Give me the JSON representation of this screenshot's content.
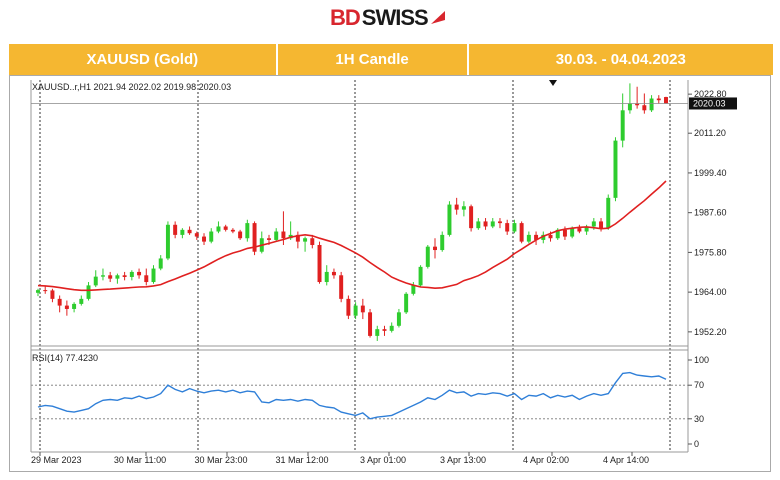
{
  "brand": {
    "bd": "BD",
    "swiss": "SWISS"
  },
  "header": {
    "symbol": "XAUUSD (Gold)",
    "timeframe": "1H Candle",
    "range": "30.03. - 04.04.2023"
  },
  "colors": {
    "header": "#f5b731",
    "bull": "#2ecc2e",
    "bear": "#e02020",
    "ma": "#e02020",
    "rsi": "#2f7fd8",
    "logo_red": "#d8262e"
  },
  "chart_data": {
    "type": "candlestick",
    "info": "XAUUSD..r,H1  2021.94 2022.02 2019.98 2020.03",
    "price_label": "2020.03",
    "y_ticks": [
      "2022.80",
      "2011.20",
      "1999.40",
      "1987.60",
      "1975.80",
      "1964.00",
      "1952.20"
    ],
    "x_ticks": [
      "29 Mar 2023",
      "30 Mar 11:00",
      "30 Mar 23:00",
      "31 Mar 12:00",
      "3 Apr 01:00",
      "3 Apr 13:00",
      "4 Apr 02:00",
      "4 Apr 14:00"
    ],
    "ylim": [
      1948,
      2027
    ],
    "ohlc": [
      [
        1963.8,
        1965,
        1962.8,
        1964.6
      ],
      [
        1964.6,
        1966,
        1963.5,
        1964.5
      ],
      [
        1964.5,
        1965,
        1961,
        1962
      ],
      [
        1962,
        1963,
        1958,
        1960
      ],
      [
        1960,
        1961.5,
        1957,
        1959
      ],
      [
        1959,
        1961,
        1958,
        1960.5
      ],
      [
        1960.5,
        1963,
        1960,
        1962
      ],
      [
        1962,
        1967,
        1961.5,
        1966
      ],
      [
        1966,
        1970.5,
        1965.5,
        1968.6
      ],
      [
        1968.6,
        1971,
        1967.5,
        1969
      ],
      [
        1969,
        1970,
        1967,
        1968
      ],
      [
        1968,
        1969.5,
        1966.5,
        1969
      ],
      [
        1969,
        1970,
        1967.5,
        1968.5
      ],
      [
        1968.5,
        1970.5,
        1967.5,
        1970
      ],
      [
        1970,
        1971,
        1968,
        1969
      ],
      [
        1969,
        1971,
        1966,
        1967
      ],
      [
        1967,
        1972,
        1966.5,
        1971
      ],
      [
        1971,
        1975,
        1970.5,
        1974
      ],
      [
        1974,
        1985,
        1973.5,
        1984
      ],
      [
        1984,
        1985,
        1980,
        1981
      ],
      [
        1981,
        1983,
        1980,
        1982.5
      ],
      [
        1982.5,
        1983.5,
        1981,
        1981.5
      ],
      [
        1981.5,
        1982,
        1979.5,
        1980.5
      ],
      [
        1980.5,
        1981.5,
        1978,
        1979
      ],
      [
        1979,
        1983,
        1978.5,
        1982
      ],
      [
        1982,
        1985,
        1981.5,
        1983.5
      ],
      [
        1983.5,
        1984,
        1982,
        1982.5
      ],
      [
        1982.5,
        1983,
        1981.5,
        1982
      ],
      [
        1982,
        1982.5,
        1979.5,
        1980
      ],
      [
        1980,
        1985.5,
        1979,
        1984.5
      ],
      [
        1984.5,
        1985,
        1975,
        1976
      ],
      [
        1976,
        1982,
        1975.5,
        1980
      ],
      [
        1980,
        1981,
        1978,
        1979.5
      ],
      [
        1979.5,
        1983,
        1979,
        1982
      ],
      [
        1982,
        1988,
        1978,
        1980
      ],
      [
        1980,
        1985,
        1979.5,
        1981
      ],
      [
        1981,
        1982,
        1977,
        1979
      ],
      [
        1979,
        1980.5,
        1976,
        1980
      ],
      [
        1980,
        1981,
        1977,
        1978
      ],
      [
        1978,
        1979,
        1966.5,
        1967
      ],
      [
        1967,
        1972,
        1966,
        1970
      ],
      [
        1970,
        1971,
        1968,
        1969
      ],
      [
        1969,
        1970,
        1961,
        1962
      ],
      [
        1962,
        1963,
        1956,
        1957
      ],
      [
        1957,
        1961,
        1956,
        1960
      ],
      [
        1960,
        1962,
        1956,
        1958
      ],
      [
        1958,
        1959,
        1950.5,
        1951
      ],
      [
        1951,
        1954,
        1949.5,
        1953
      ],
      [
        1953,
        1954,
        1951,
        1952.5
      ],
      [
        1952.5,
        1955,
        1952,
        1954
      ],
      [
        1954,
        1959,
        1953.5,
        1958
      ],
      [
        1958,
        1964,
        1957.5,
        1963.5
      ],
      [
        1963.5,
        1967,
        1963,
        1966
      ],
      [
        1966,
        1972,
        1965.5,
        1971.5
      ],
      [
        1971.5,
        1978,
        1971,
        1977.5
      ],
      [
        1977.5,
        1980,
        1974,
        1976.5
      ],
      [
        1976.5,
        1982,
        1976,
        1981
      ],
      [
        1981,
        1991,
        1980.5,
        1990
      ],
      [
        1990,
        1992,
        1987,
        1988.5
      ],
      [
        1988.5,
        1991,
        1986.5,
        1989.5
      ],
      [
        1989.5,
        1990,
        1982,
        1983
      ],
      [
        1983,
        1986,
        1982.5,
        1985
      ],
      [
        1985,
        1986,
        1982.5,
        1983.5
      ],
      [
        1983.5,
        1986,
        1983,
        1985
      ],
      [
        1985,
        1986,
        1983,
        1984.5
      ],
      [
        1984.5,
        1985.5,
        1981,
        1982
      ],
      [
        1982,
        1985.5,
        1981.5,
        1984.5
      ],
      [
        1984.5,
        1985,
        1978.5,
        1979
      ],
      [
        1979,
        1982,
        1978.5,
        1981
      ],
      [
        1981,
        1982,
        1978,
        1979.5
      ],
      [
        1979.5,
        1982,
        1978.5,
        1981
      ],
      [
        1981,
        1982,
        1979,
        1980
      ],
      [
        1980,
        1983,
        1979.5,
        1982.5
      ],
      [
        1982.5,
        1983.5,
        1979.5,
        1980.5
      ],
      [
        1980.5,
        1983.5,
        1980,
        1983
      ],
      [
        1983,
        1984,
        1981.5,
        1982
      ],
      [
        1982,
        1984,
        1981,
        1983.5
      ],
      [
        1983.5,
        1986,
        1982.5,
        1985
      ],
      [
        1985,
        1986,
        1982,
        1983
      ],
      [
        1983,
        1993,
        1982.5,
        1992
      ],
      [
        1992,
        2010,
        1991,
        2009
      ],
      [
        2009,
        2023,
        2007,
        2018
      ],
      [
        2018,
        2026,
        2017,
        2020
      ],
      [
        2020,
        2025,
        2018.5,
        2019.5
      ],
      [
        2019.5,
        2023,
        2017,
        2018
      ],
      [
        2018,
        2022.5,
        2017.5,
        2021.5
      ],
      [
        2021.5,
        2022.5,
        2020,
        2021
      ],
      [
        2021.94,
        2022.02,
        2019.98,
        2020.03
      ]
    ],
    "ma_label": "",
    "rsi_label": "RSI(14) 77.4230",
    "rsi_ticks": [
      "100",
      "70",
      "30",
      "0"
    ],
    "rsi_levels": [
      70,
      30
    ],
    "rsi": [
      44,
      46,
      45,
      42,
      39,
      38,
      40,
      42,
      48,
      52,
      53,
      52,
      55,
      54,
      57,
      54,
      56,
      60,
      70,
      65,
      62,
      66,
      63,
      61,
      63,
      64,
      62,
      64,
      61,
      63,
      62,
      50,
      49,
      53,
      52,
      53,
      51,
      53,
      52,
      46,
      44,
      43,
      38,
      36,
      34,
      37,
      30,
      32,
      33,
      34,
      38,
      42,
      46,
      50,
      55,
      53,
      58,
      64,
      61,
      62,
      57,
      60,
      59,
      61,
      60,
      57,
      60,
      53,
      58,
      57,
      60,
      55,
      58,
      56,
      58,
      53,
      57,
      60,
      58,
      60,
      73,
      84,
      85,
      82,
      81,
      80,
      81,
      77
    ]
  }
}
